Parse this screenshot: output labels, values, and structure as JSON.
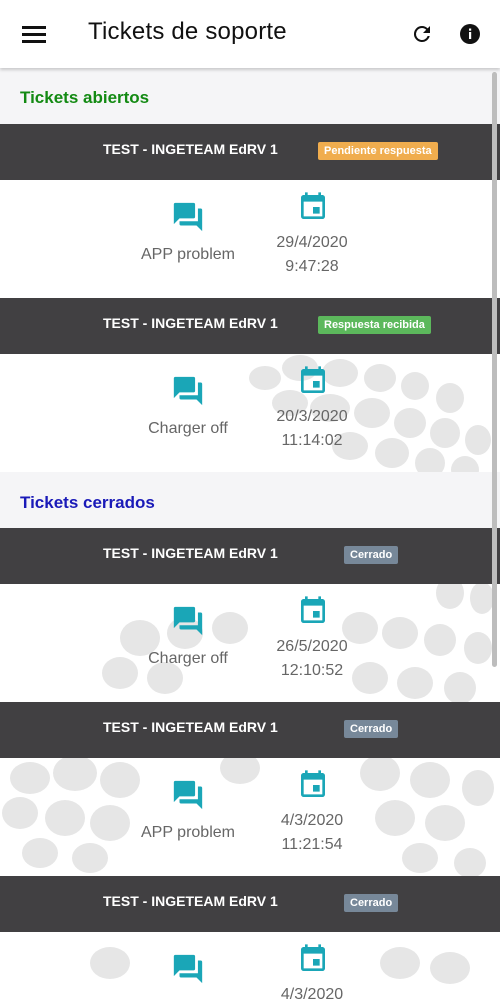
{
  "appbar": {
    "title": "Tickets de soporte",
    "menu_icon": "menu-icon",
    "refresh_icon": "refresh-icon",
    "info_icon": "info-icon"
  },
  "colors": {
    "open_section": "#138a13",
    "closed_section": "#1a1ab8",
    "ticket_header": "#414042",
    "accent": "#1aa6b7",
    "pending": "#f0ad4e",
    "received": "#5cb85c",
    "closed": "#778899"
  },
  "sections": {
    "open": {
      "label": "Tickets abiertos"
    },
    "closed": {
      "label": "Tickets cerrados"
    }
  },
  "tickets": [
    {
      "title": "TEST - INGETEAM EdRV 1",
      "status": "Pendiente respuesta",
      "subject": "APP problem",
      "date": "29/4/2020",
      "time": "9:47:28"
    },
    {
      "title": "TEST - INGETEAM EdRV 1",
      "status": "Respuesta recibida",
      "subject": "Charger off",
      "date": "20/3/2020",
      "time": "11:14:02"
    },
    {
      "title": "TEST - INGETEAM EdRV 1",
      "status": "Cerrado",
      "subject": "Charger off",
      "date": "26/5/2020",
      "time": "12:10:52"
    },
    {
      "title": "TEST - INGETEAM EdRV 1",
      "status": "Cerrado",
      "subject": "APP problem",
      "date": "4/3/2020",
      "time": "11:21:54"
    },
    {
      "title": "TEST - INGETEAM EdRV 1",
      "status": "Cerrado",
      "subject": "",
      "date": "4/3/2020",
      "time": ""
    }
  ]
}
